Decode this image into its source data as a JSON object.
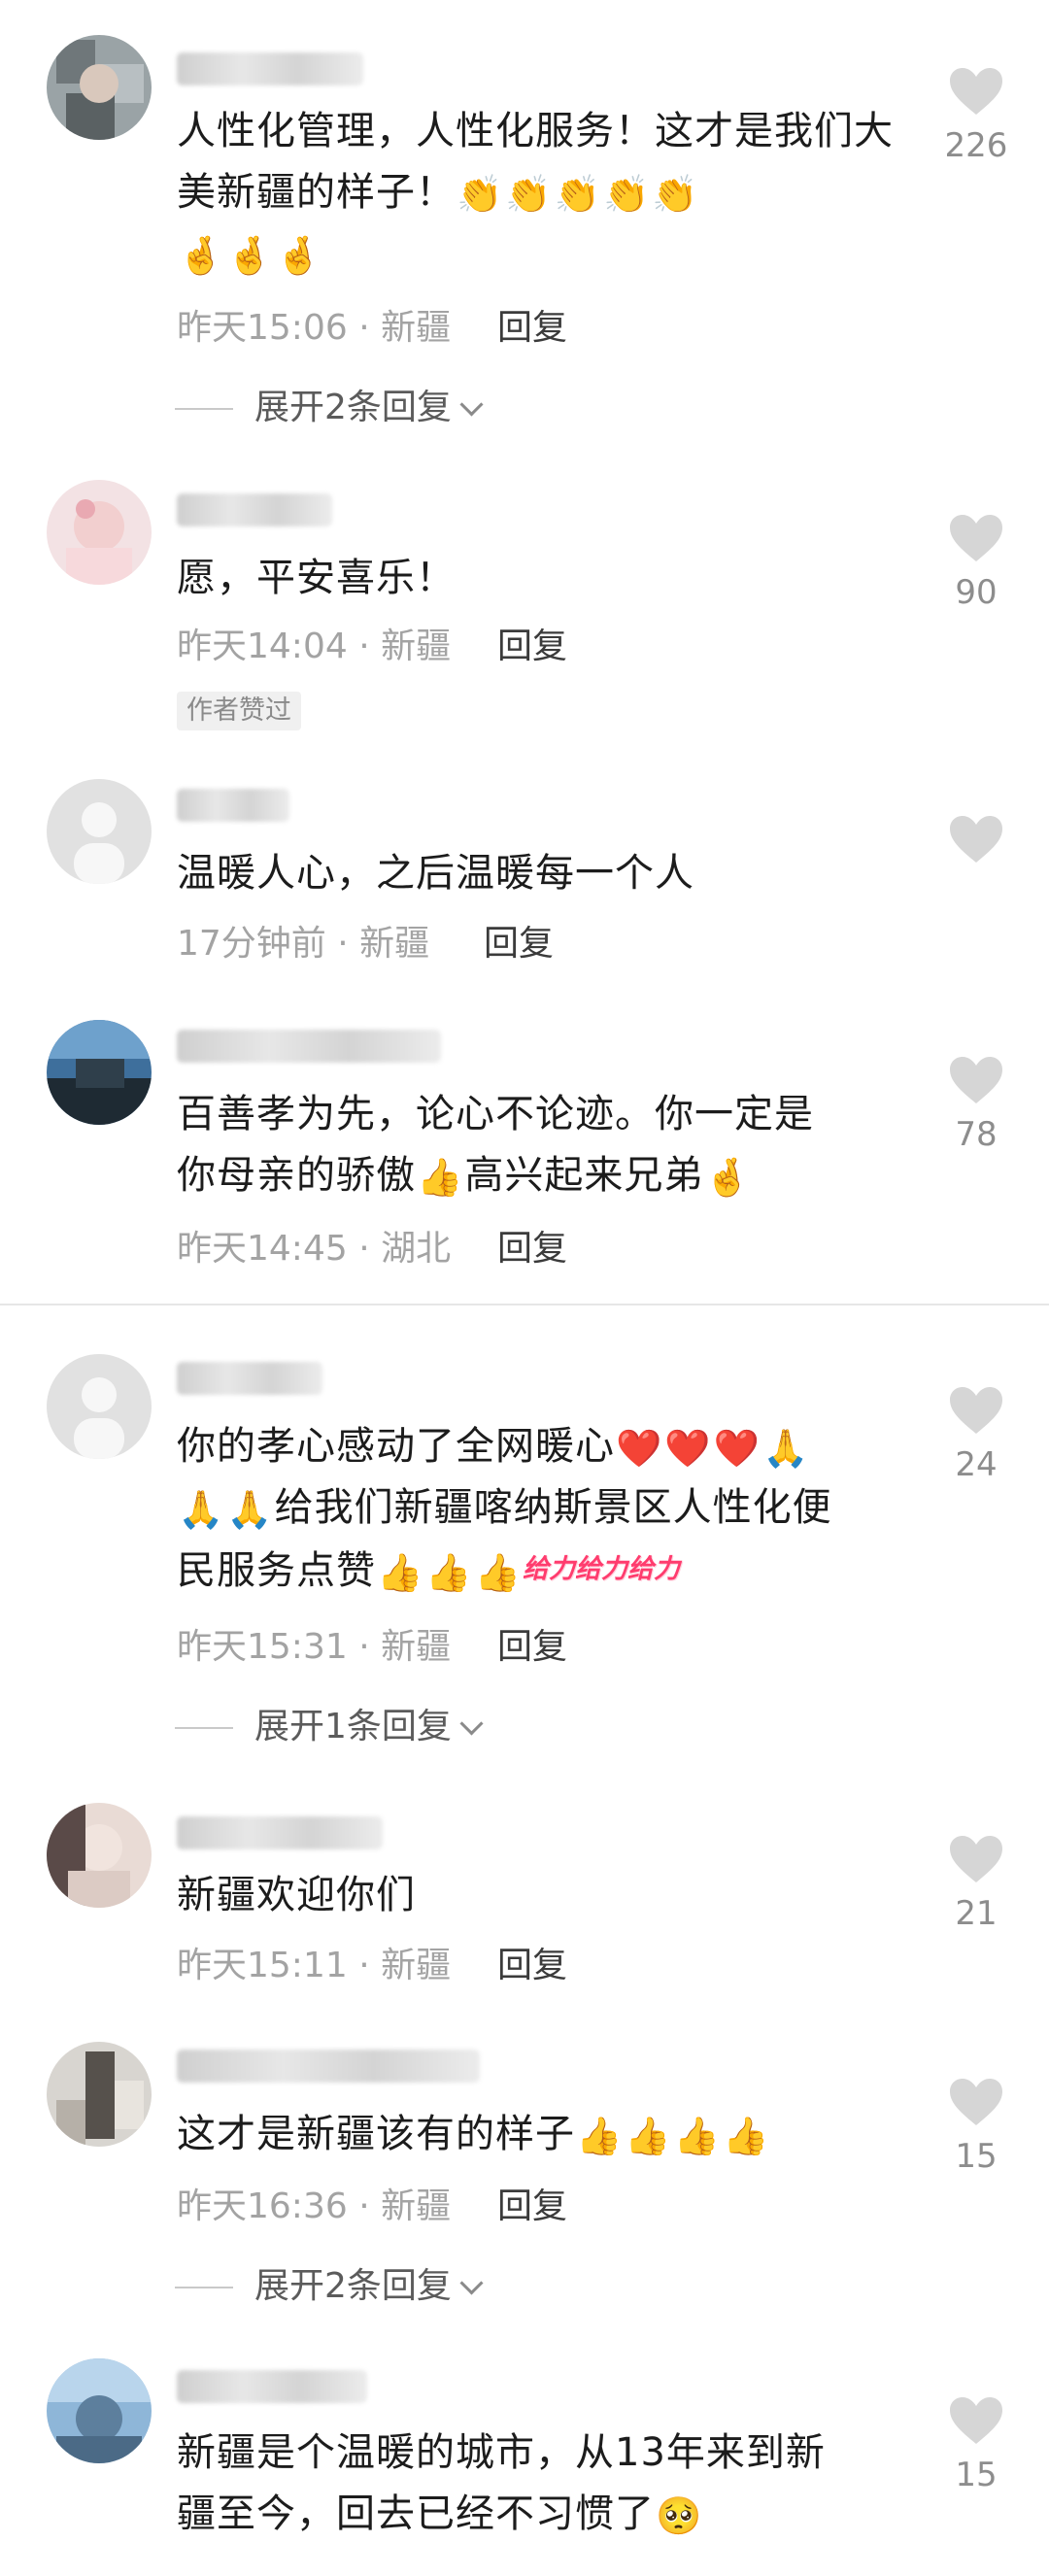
{
  "colors": {
    "heart": "#d6d6d6",
    "text": "#1c1c1c",
    "meta": "#a3a3a3",
    "badge_bg": "#f0f0f0"
  },
  "comments": [
    {
      "content_text": "人性化管理，人性化服务！这才是我们大美新疆的样子！",
      "emojis": [
        "👏",
        "👏",
        "👏",
        "👏",
        "👏",
        "🤞",
        "🤞",
        "🤞"
      ],
      "time": "昨天15:06 · 新疆",
      "reply": "回复",
      "likes": "226",
      "expand": "展开2条回复"
    },
    {
      "content_text": "愿，平安喜乐！",
      "time": "昨天14:04 · 新疆",
      "reply": "回复",
      "likes": "90",
      "badge": "作者赞过"
    },
    {
      "content_text": "温暖人心，之后温暖每一个人",
      "time": "17分钟前 · 新疆",
      "reply": "回复",
      "likes": ""
    },
    {
      "content_line1": "百善孝为先，论心不论迹。你一定是",
      "content_line2a": "你母亲的骄傲",
      "content_line2b": "高兴起来兄弟",
      "emojis": [
        "👍",
        "🤞"
      ],
      "time": "昨天14:45 · 湖北",
      "reply": "回复",
      "likes": "78"
    },
    {
      "content_line1": "你的孝心感动了全网暖心",
      "content_line2": "给我们新疆喀纳斯景区人性化便",
      "content_line3": "民服务点赞",
      "geili": "给力给力给力",
      "emojis": [
        "❤️",
        "❤️",
        "❤️",
        "🙏",
        "🙏",
        "🙏",
        "👍",
        "👍",
        "👍"
      ],
      "time": "昨天15:31 · 新疆",
      "reply": "回复",
      "likes": "24",
      "expand": "展开1条回复"
    },
    {
      "content_text": "新疆欢迎你们",
      "time": "昨天15:11 · 新疆",
      "reply": "回复",
      "likes": "21"
    },
    {
      "content_text": "这才是新疆该有的样子",
      "emojis": [
        "👍",
        "👍",
        "👍",
        "👍"
      ],
      "time": "昨天16:36 · 新疆",
      "reply": "回复",
      "likes": "15",
      "expand": "展开2条回复"
    },
    {
      "content_line1": "新疆是个温暖的城市，从13年来到新",
      "content_line2": "疆至今，回去已经不习惯了",
      "emojis": [
        "🥺"
      ],
      "likes": "15"
    }
  ]
}
